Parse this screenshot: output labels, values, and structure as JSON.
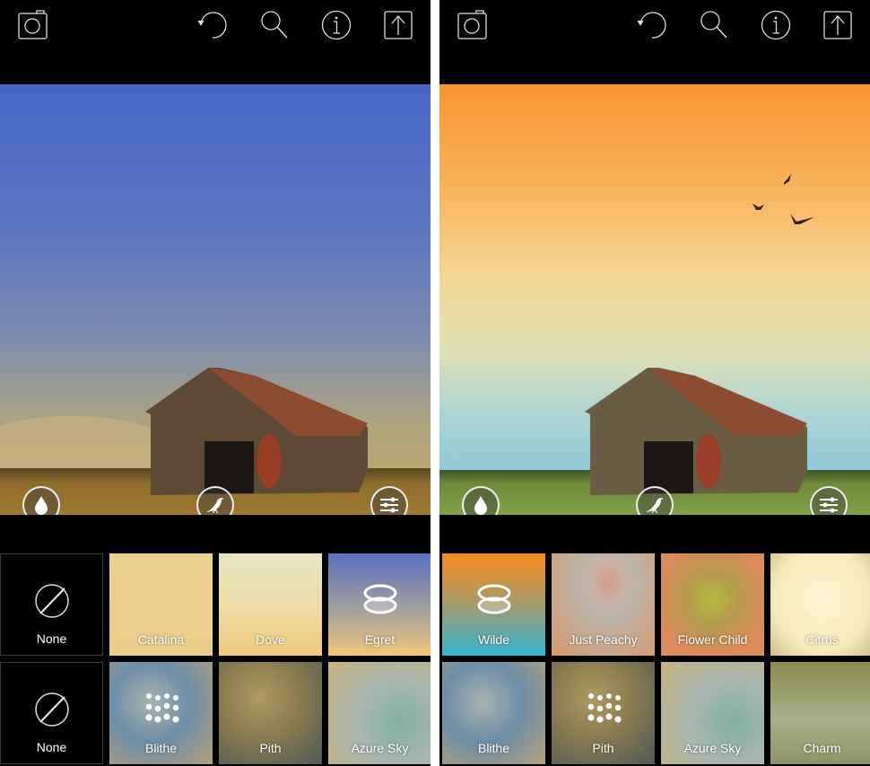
{
  "panels": [
    {
      "id": "left",
      "toolbar": {
        "camera": "camera-icon",
        "undo": "undo-icon",
        "search": "search-icon",
        "info": "info-icon",
        "share": "share-icon"
      },
      "photo": {
        "description": "Barn at dusk with blue textured sky",
        "sky_top": "#4a6bc4",
        "sky_mid": "#6f85b8",
        "sky_low": "#b7a979",
        "ground": "#8a6a2a"
      },
      "photo_buttons": [
        "drop-icon",
        "bird-icon",
        "sliders-icon"
      ],
      "tiles_row1": [
        {
          "label": "None",
          "type": "none"
        },
        {
          "label": "Catalina",
          "colors": [
            "#ecd08e",
            "#ebcd8a"
          ]
        },
        {
          "label": "Dove",
          "colors": [
            "#e6e6c6",
            "#f1c97d"
          ]
        },
        {
          "label": "Egret",
          "colors": [
            "#5a6fc0",
            "#f2c779"
          ],
          "icon": "rings-icon"
        }
      ],
      "tiles_row2": [
        {
          "label": "None",
          "type": "none"
        },
        {
          "label": "Blithe",
          "colors": [
            "#6d8fa9",
            "#b5a07a"
          ],
          "icon": "dots-icon"
        },
        {
          "label": "Pith",
          "colors": [
            "#8a7a4f",
            "#4e5a55"
          ]
        },
        {
          "label": "Azure Sky",
          "colors": [
            "#a9b7b0",
            "#7fb0a2"
          ]
        }
      ]
    },
    {
      "id": "right",
      "toolbar": {
        "camera": "camera-icon",
        "undo": "undo-icon",
        "search": "search-icon",
        "info": "info-icon",
        "share": "share-icon"
      },
      "photo": {
        "description": "Barn with orange-to-turquoise textured sky and birds",
        "sky_top": "#fa9a32",
        "sky_mid": "#f4d697",
        "sky_low": "#8ec9d8",
        "ground": "#6f8a3a"
      },
      "photo_buttons": [
        "drop-icon",
        "bird-icon",
        "sliders-icon"
      ],
      "tiles_row1": [
        {
          "label": "Wilde",
          "colors": [
            "#f98a1d",
            "#35b5d6"
          ],
          "icon": "rings-icon"
        },
        {
          "label": "Just Peachy",
          "colors": [
            "#bdb4a8",
            "#d8976a"
          ]
        },
        {
          "label": "Flower Child",
          "colors": [
            "#b1b93e",
            "#dd8a5c"
          ]
        },
        {
          "label": "Citrus",
          "colors": [
            "#fdf5d4",
            "#cbbd8a"
          ]
        }
      ],
      "tiles_row2": [
        {
          "label": "Blithe",
          "colors": [
            "#6d8fa9",
            "#b5a07a"
          ]
        },
        {
          "label": "Pith",
          "colors": [
            "#8a7a4f",
            "#4e5a55"
          ],
          "icon": "dots-icon"
        },
        {
          "label": "Azure Sky",
          "colors": [
            "#a9b7b0",
            "#7fb0a2"
          ]
        },
        {
          "label": "Charm",
          "colors": [
            "#8a8a4a",
            "#a7b08a"
          ]
        }
      ]
    }
  ]
}
